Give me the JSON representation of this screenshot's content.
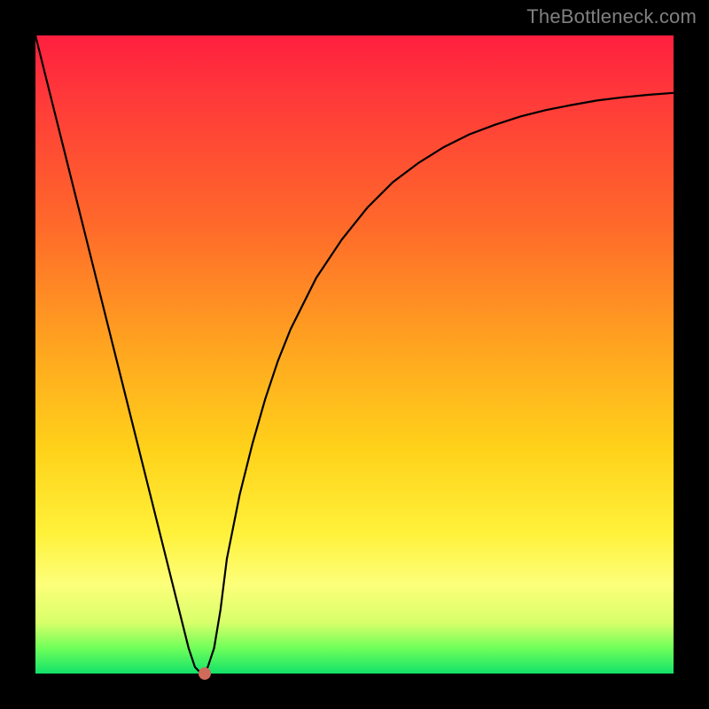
{
  "watermark": "TheBottleneck.com",
  "colors": {
    "frame": "#000000",
    "gradient_top": "#ff1f3f",
    "gradient_bottom": "#12e26a",
    "curve": "#000000",
    "marker": "#d06a5a"
  },
  "chart_data": {
    "type": "line",
    "title": "",
    "xlabel": "",
    "ylabel": "",
    "xlim": [
      0,
      100
    ],
    "ylim": [
      0,
      100
    ],
    "x": [
      0,
      2,
      4,
      6,
      8,
      10,
      12,
      14,
      16,
      18,
      20,
      22,
      24,
      25,
      26,
      27,
      28,
      29,
      30,
      32,
      34,
      36,
      38,
      40,
      44,
      48,
      52,
      56,
      60,
      64,
      68,
      72,
      76,
      80,
      84,
      88,
      92,
      96,
      100
    ],
    "y": [
      100,
      92,
      84,
      76,
      68,
      60,
      52,
      44,
      36,
      28,
      20,
      12,
      4,
      1,
      0,
      1,
      4,
      10,
      18,
      28,
      36,
      43,
      49,
      54,
      62,
      68,
      73,
      77,
      80,
      82.5,
      84.5,
      86,
      87.3,
      88.3,
      89.1,
      89.8,
      90.3,
      90.7,
      91
    ],
    "marker": {
      "x": 26.5,
      "y": 0
    },
    "grid": false,
    "legend": false
  }
}
